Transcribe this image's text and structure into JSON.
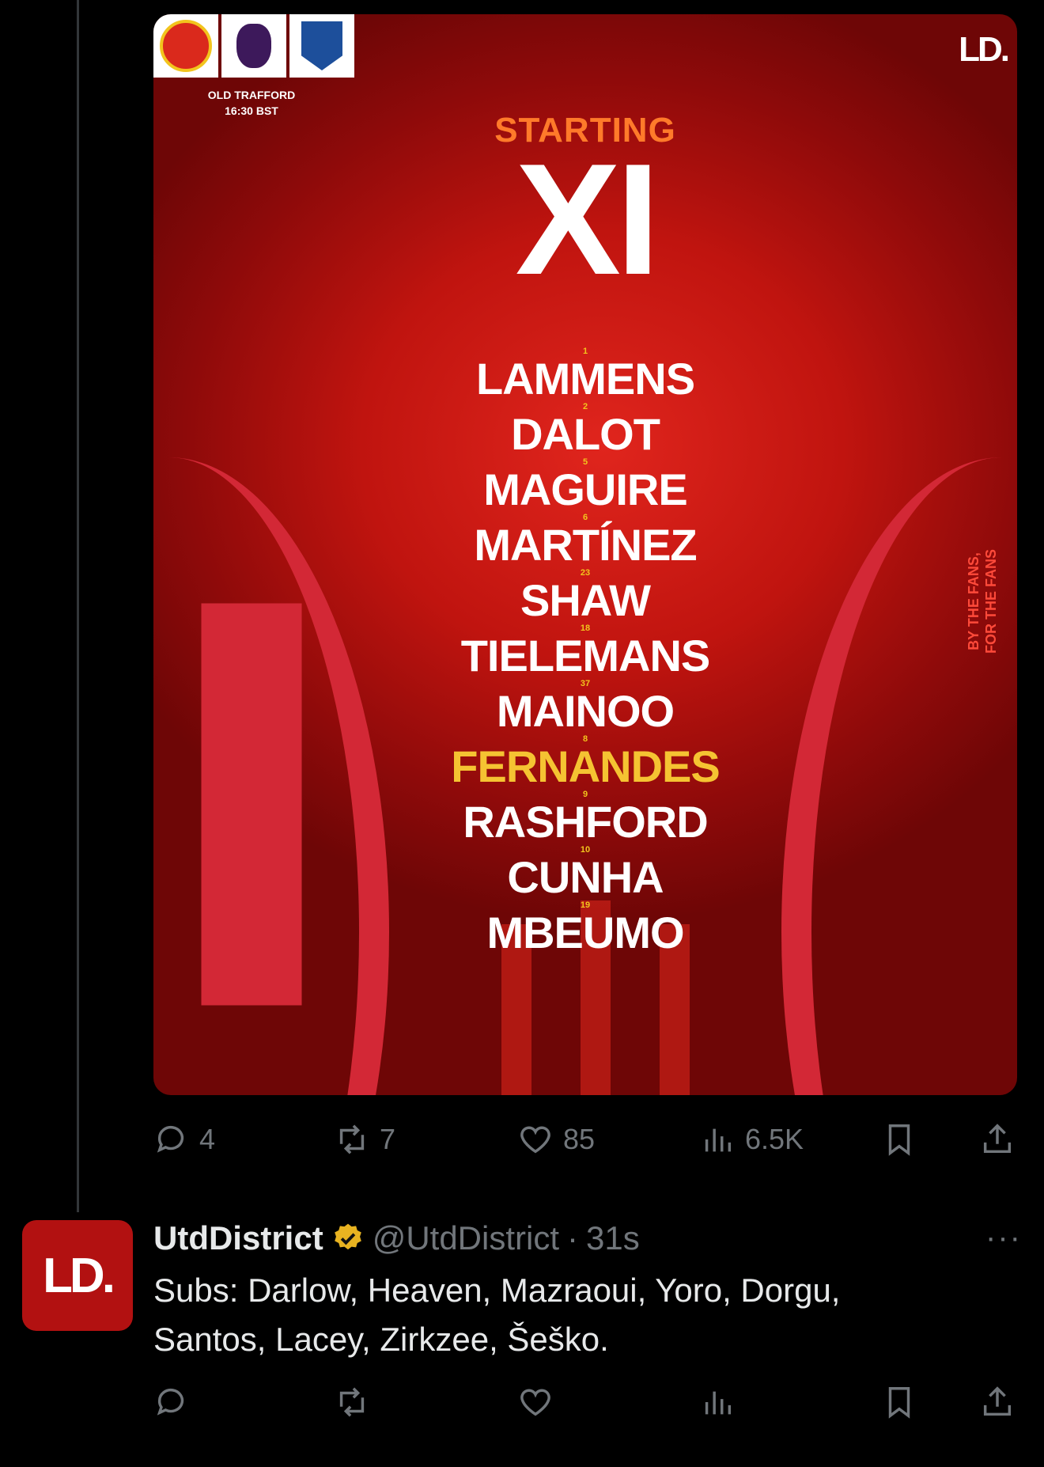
{
  "tweet1": {
    "graphic": {
      "venue": "OLD TRAFFORD",
      "kickoff": "16:30 BST",
      "brand": "LD.",
      "title_top": "STARTING",
      "title_main": "XI",
      "tagline_1": "BY THE FANS,",
      "tagline_2": "FOR THE FANS",
      "players": [
        {
          "number": "1",
          "name": "LAMMENS"
        },
        {
          "number": "2",
          "name": "DALOT"
        },
        {
          "number": "5",
          "name": "MAGUIRE"
        },
        {
          "number": "6",
          "name": "MARTÍNEZ"
        },
        {
          "number": "23",
          "name": "SHAW"
        },
        {
          "number": "18",
          "name": "TIELEMANS"
        },
        {
          "number": "37",
          "name": "MAINOO"
        },
        {
          "number": "8",
          "name": "FERNANDES"
        },
        {
          "number": "9",
          "name": "RASHFORD"
        },
        {
          "number": "10",
          "name": "CUNHA"
        },
        {
          "number": "19",
          "name": "MBEUMO"
        }
      ],
      "colors": {
        "background": "#c0140f",
        "title_orange": "#ff7a2a",
        "captain_yellow": "#f5c332"
      }
    },
    "actions": {
      "replies": "4",
      "reposts": "7",
      "likes": "85",
      "views": "6.5K"
    }
  },
  "tweet2": {
    "avatar_text": "LD.",
    "display_name": "UtdDistrict",
    "handle": "@UtdDistrict",
    "separator": "·",
    "time": "31s",
    "more": "···",
    "text_line1": "Subs: Darlow, Heaven, Mazraoui, Yoro, Dorgu,",
    "text_line2": "Santos, Lacey, Zirkzee, Šeško."
  },
  "icons": [
    "reply-icon",
    "repost-icon",
    "like-icon",
    "views-icon",
    "bookmark-icon",
    "share-icon",
    "verified-icon",
    "more-icon"
  ]
}
